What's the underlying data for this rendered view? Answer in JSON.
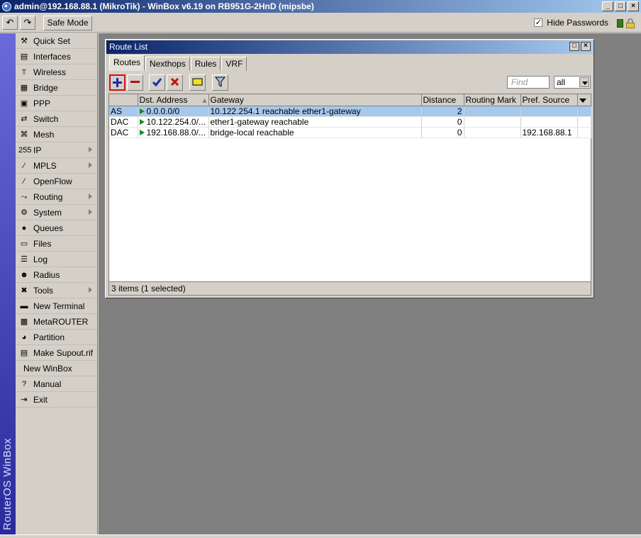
{
  "window": {
    "title": "admin@192.168.88.1 (MikroTik) - WinBox v6.19 on RB951G-2HnD (mipsbe)",
    "min": "_",
    "max": "□",
    "close": "×"
  },
  "toolbar": {
    "undo": "↶",
    "redo": "↷",
    "safe_mode": "Safe Mode",
    "hide_passwords_label": "Hide Passwords",
    "hide_passwords_checked": "✓"
  },
  "brand": "RouterOS WinBox",
  "menu": [
    {
      "label": "Quick Set",
      "icon": "quick-set-icon",
      "glyph": "⚒",
      "submenu": false
    },
    {
      "label": "Interfaces",
      "icon": "interfaces-icon",
      "glyph": "▤",
      "submenu": false
    },
    {
      "label": "Wireless",
      "icon": "wireless-icon",
      "glyph": "⫪",
      "submenu": false
    },
    {
      "label": "Bridge",
      "icon": "bridge-icon",
      "glyph": "▦",
      "submenu": false
    },
    {
      "label": "PPP",
      "icon": "ppp-icon",
      "glyph": "▣",
      "submenu": false
    },
    {
      "label": "Switch",
      "icon": "switch-icon",
      "glyph": "⇄",
      "submenu": false
    },
    {
      "label": "Mesh",
      "icon": "mesh-icon",
      "glyph": "⌘",
      "submenu": false
    },
    {
      "label": "IP",
      "icon": "ip-icon",
      "glyph": "255",
      "submenu": true
    },
    {
      "label": "MPLS",
      "icon": "mpls-icon",
      "glyph": "∕",
      "submenu": true
    },
    {
      "label": "OpenFlow",
      "icon": "openflow-icon",
      "glyph": "∕",
      "submenu": false
    },
    {
      "label": "Routing",
      "icon": "routing-icon",
      "glyph": "⤳",
      "submenu": true
    },
    {
      "label": "System",
      "icon": "system-icon",
      "glyph": "⚙",
      "submenu": true
    },
    {
      "label": "Queues",
      "icon": "queues-icon",
      "glyph": "●",
      "submenu": false
    },
    {
      "label": "Files",
      "icon": "files-icon",
      "glyph": "▭",
      "submenu": false
    },
    {
      "label": "Log",
      "icon": "log-icon",
      "glyph": "☰",
      "submenu": false
    },
    {
      "label": "Radius",
      "icon": "radius-icon",
      "glyph": "☻",
      "submenu": false
    },
    {
      "label": "Tools",
      "icon": "tools-icon",
      "glyph": "✖",
      "submenu": true
    },
    {
      "label": "New Terminal",
      "icon": "terminal-icon",
      "glyph": "▬",
      "submenu": false
    },
    {
      "label": "MetaROUTER",
      "icon": "metarouter-icon",
      "glyph": "▩",
      "submenu": false
    },
    {
      "label": "Partition",
      "icon": "partition-icon",
      "glyph": "◕",
      "submenu": false
    },
    {
      "label": "Make Supout.rif",
      "icon": "supout-icon",
      "glyph": "▤",
      "submenu": false
    },
    {
      "label": "New WinBox",
      "icon": "",
      "glyph": "",
      "submenu": false
    },
    {
      "label": "Manual",
      "icon": "manual-icon",
      "glyph": "?",
      "submenu": false
    },
    {
      "label": "Exit",
      "icon": "exit-icon",
      "glyph": "⇥",
      "submenu": false
    }
  ],
  "route_list": {
    "title": "Route List",
    "tabs": [
      "Routes",
      "Nexthops",
      "Rules",
      "VRF"
    ],
    "find_placeholder": "Find",
    "filter_value": "all",
    "columns": [
      "",
      "Dst. Address",
      "Gateway",
      "Distance",
      "Routing Mark",
      "Pref. Source"
    ],
    "rows": [
      {
        "flags": "AS",
        "dst": "0.0.0.0/0",
        "gateway": "10.122.254.1 reachable ether1-gateway",
        "distance": "2",
        "mark": "",
        "pref_src": ""
      },
      {
        "flags": "DAC",
        "dst": "10.122.254.0/...",
        "gateway": "ether1-gateway reachable",
        "distance": "0",
        "mark": "",
        "pref_src": ""
      },
      {
        "flags": "DAC",
        "dst": "192.168.88.0/...",
        "gateway": "bridge-local reachable",
        "distance": "0",
        "mark": "",
        "pref_src": "192.168.88.1"
      }
    ],
    "status": "3 items (1 selected)"
  },
  "colors": {
    "titlebar_start": "#0a246a",
    "titlebar_end": "#a6caf0",
    "selected_row": "#a6c8ec",
    "add_icon": "#1a2fa8",
    "remove_icon": "#b01010"
  }
}
